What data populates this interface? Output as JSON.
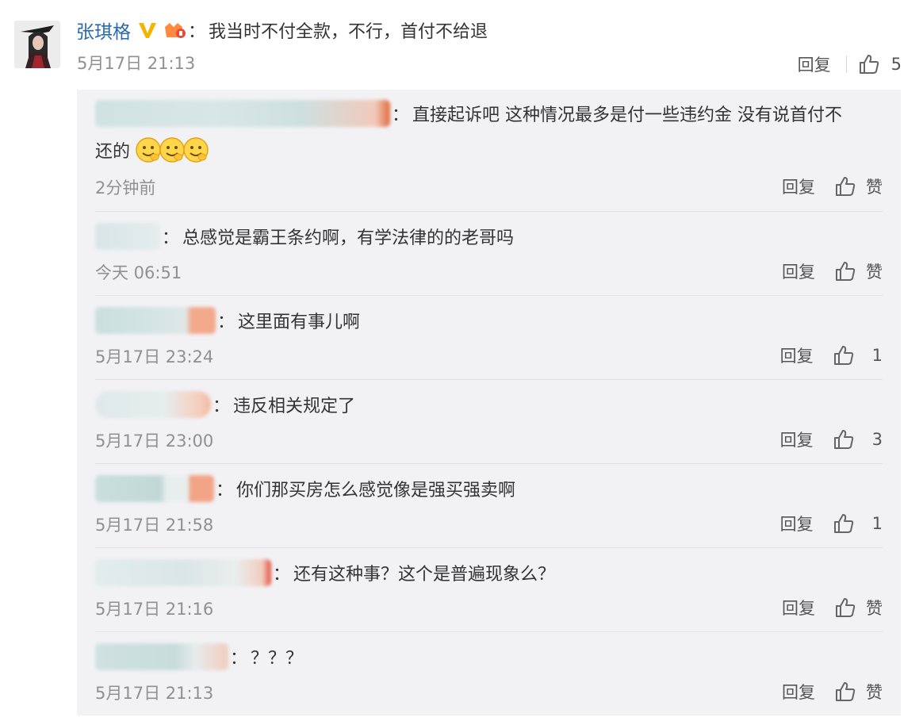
{
  "main_comment": {
    "username": "张琪格",
    "text": "我当时不付全款，不行，首付不给退",
    "time": "5月17日 21:13",
    "reply_label": "回复",
    "like_count": "5"
  },
  "colon": "：",
  "replies": [
    {
      "text_line1": "直接起诉吧 这种情况最多是付一些违约金 没有说首付不",
      "text_line2": "还的",
      "emoji_count": 3,
      "time": "2分钟前",
      "reply_label": "回复",
      "like_label": "赞"
    },
    {
      "text_line1": "总感觉是霸王条约啊，有学法律的的老哥吗",
      "time": "今天 06:51",
      "reply_label": "回复",
      "like_label": "赞"
    },
    {
      "text_line1": "这里面有事儿啊",
      "time": "5月17日 23:24",
      "reply_label": "回复",
      "like_label": "1"
    },
    {
      "text_line1": "违反相关规定了",
      "time": "5月17日 23:00",
      "reply_label": "回复",
      "like_label": "3"
    },
    {
      "text_line1": "你们那买房怎么感觉像是强买强卖啊",
      "time": "5月17日 21:58",
      "reply_label": "回复",
      "like_label": "1"
    },
    {
      "text_line1": "还有这种事？这个是普遍现象么？",
      "time": "5月17日 21:16",
      "reply_label": "回复",
      "like_label": "赞"
    },
    {
      "text_line1": "？？？",
      "time": "5月17日 21:13",
      "reply_label": "回复",
      "like_label": "赞"
    }
  ],
  "colors": {
    "username": "#2b6aa8",
    "text": "#333333",
    "meta": "#909090",
    "sub_background": "#f2f2f5"
  }
}
